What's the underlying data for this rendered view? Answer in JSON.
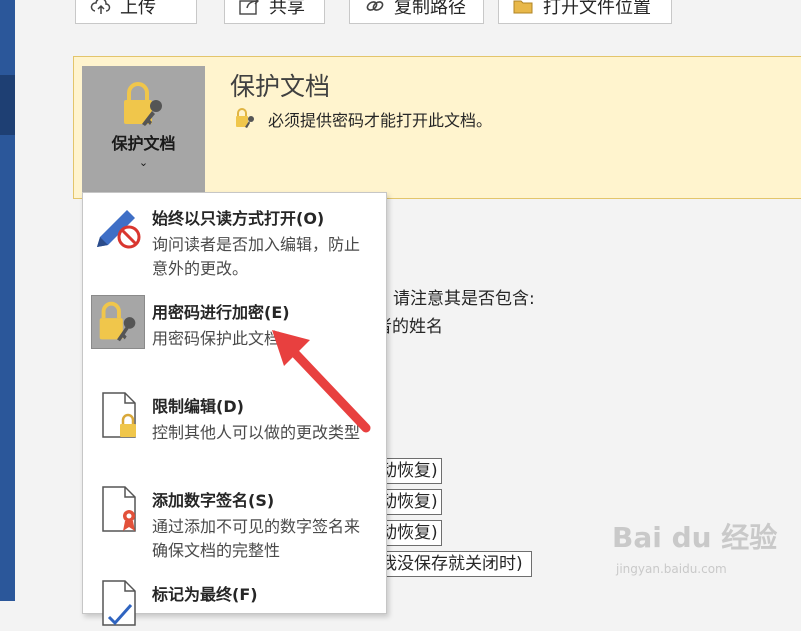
{
  "top_buttons": [
    {
      "label": "上传",
      "icon": "upload-cloud-icon"
    },
    {
      "label": "共享",
      "icon": "share-icon"
    },
    {
      "label": "复制路径",
      "icon": "link-icon"
    },
    {
      "label": "打开文件位置",
      "icon": "folder-icon"
    }
  ],
  "protect": {
    "button_label": "保护文档",
    "button_chevron": "⌄",
    "title": "保护文档",
    "description": "必须提供密码才能打开此文档。"
  },
  "background": {
    "notice": "请注意其是否包含:",
    "author_fragment": "者的姓名",
    "versions": [
      "动恢复)",
      "动恢复)",
      "动恢复)",
      "我没保存就关闭时)"
    ]
  },
  "menu": {
    "items": [
      {
        "title": "始终以只读方式打开(O)",
        "desc": "询问读者是否加入编辑，防止意外的更改。",
        "icon": "pencil-no-icon"
      },
      {
        "title": "用密码进行加密(E)",
        "desc": "用密码保护此文档",
        "icon": "lock-key-icon",
        "selected": true
      },
      {
        "title": "限制编辑(D)",
        "desc": "控制其他人可以做的更改类型",
        "icon": "document-lock-icon"
      },
      {
        "title": "添加数字签名(S)",
        "desc": "通过添加不可见的数字签名来确保文档的完整性",
        "icon": "document-ribbon-icon"
      },
      {
        "title": "标记为最终(F)",
        "desc": "",
        "icon": "document-check-icon"
      }
    ]
  },
  "watermark": {
    "logo": "Bai du 经验",
    "url": "jingyan.baidu.com"
  },
  "colors": {
    "infobar": "#fff4ce",
    "selected": "#a6a6a6",
    "arrow": "#e8403f",
    "lock": "#f0c64b",
    "brand": "#2b579a"
  }
}
